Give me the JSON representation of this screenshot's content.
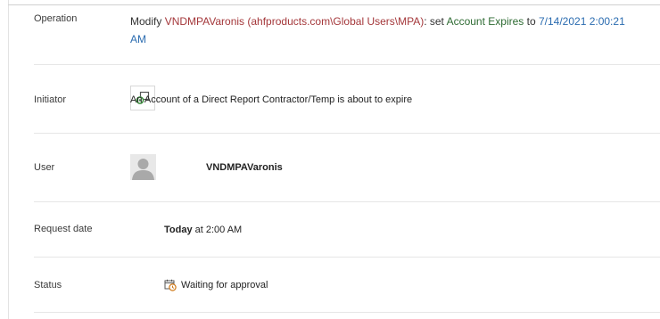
{
  "operation": {
    "label": "Operation",
    "prefix": "Modify ",
    "target": "VNDMPAVaronis (ahfproducts.com\\Global Users\\MPA)",
    "sep": ": set ",
    "attribute": "Account Expires",
    "to_word": " to ",
    "new_value": "7/14/2021 2:00:21 AM"
  },
  "initiator": {
    "label": "Initiator",
    "icon": "workflow-icon",
    "text": "An Account of a Direct Report Contractor/Temp is about to expire"
  },
  "user": {
    "label": "User",
    "icon": "user-avatar-icon",
    "name": "VNDMPAVaronis"
  },
  "request_date": {
    "label": "Request date",
    "day": "Today",
    "time": " at 2:00 AM"
  },
  "status": {
    "label": "Status",
    "icon": "clock-calendar-icon",
    "text": "Waiting for approval"
  },
  "colors": {
    "target": "#a4373a",
    "attribute": "#2e6b33",
    "value": "#2b6cb0",
    "icon_green": "#3c8f3f"
  }
}
